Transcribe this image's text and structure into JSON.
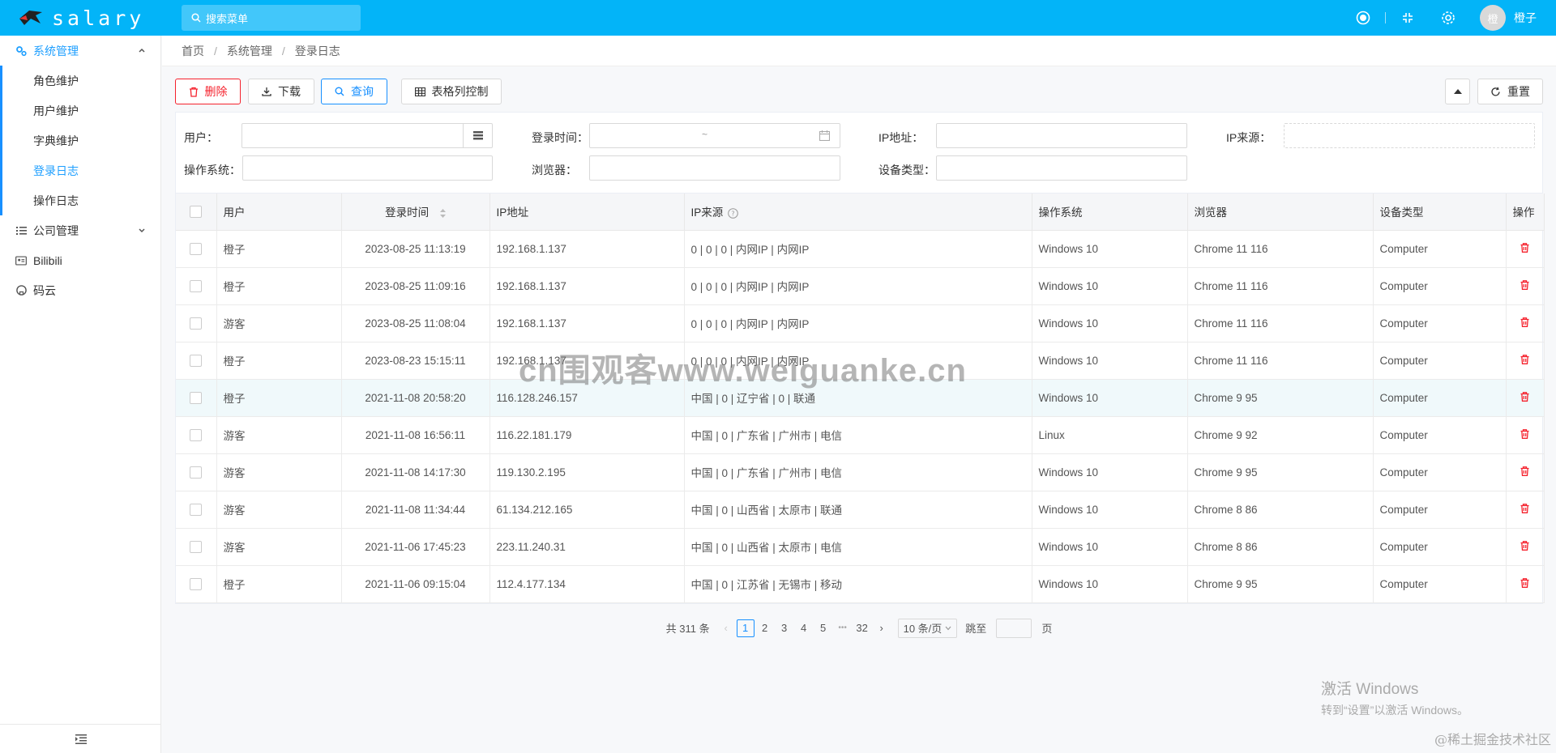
{
  "header": {
    "logo_text": "salary",
    "search_placeholder": "搜索菜单",
    "username": "橙子",
    "avatar_char": "橙"
  },
  "sidebar": {
    "groups": [
      {
        "label": "系统管理",
        "icon": "gears-icon",
        "expanded": true,
        "items": [
          "角色维护",
          "用户维护",
          "字典维护",
          "登录日志",
          "操作日志"
        ],
        "active_item": "登录日志"
      },
      {
        "label": "公司管理",
        "icon": "list-icon",
        "expanded": false
      },
      {
        "label": "Bilibili",
        "icon": "id-card-icon"
      },
      {
        "label": "码云",
        "icon": "github-icon"
      }
    ]
  },
  "breadcrumb": [
    "首页",
    "系统管理",
    "登录日志"
  ],
  "toolbar": {
    "delete": "删除",
    "download": "下载",
    "query": "查询",
    "column_control": "表格列控制",
    "reset": "重置"
  },
  "filters": {
    "user": "用户：",
    "login_time": "登录时间：",
    "range_sep": "~",
    "ip": "IP地址：",
    "ip_source": "IP来源：",
    "os": "操作系统：",
    "browser": "浏览器：",
    "device": "设备类型："
  },
  "table": {
    "columns": [
      "用户",
      "登录时间",
      "IP地址",
      "IP来源",
      "操作系统",
      "浏览器",
      "设备类型",
      "操作"
    ],
    "rows": [
      [
        "橙子",
        "2023-08-25 11:13:19",
        "192.168.1.137",
        "0 | 0 | 0 | 内网IP | 内网IP",
        "Windows 10",
        "Chrome 11 116",
        "Computer"
      ],
      [
        "橙子",
        "2023-08-25 11:09:16",
        "192.168.1.137",
        "0 | 0 | 0 | 内网IP | 内网IP",
        "Windows 10",
        "Chrome 11 116",
        "Computer"
      ],
      [
        "游客",
        "2023-08-25 11:08:04",
        "192.168.1.137",
        "0 | 0 | 0 | 内网IP | 内网IP",
        "Windows 10",
        "Chrome 11 116",
        "Computer"
      ],
      [
        "橙子",
        "2023-08-23 15:15:11",
        "192.168.1.137",
        "0 | 0 | 0 | 内网IP | 内网IP",
        "Windows 10",
        "Chrome 11 116",
        "Computer"
      ],
      [
        "橙子",
        "2021-11-08 20:58:20",
        "116.128.246.157",
        "中国 | 0 | 辽宁省 | 0 | 联通",
        "Windows 10",
        "Chrome 9 95",
        "Computer"
      ],
      [
        "游客",
        "2021-11-08 16:56:11",
        "116.22.181.179",
        "中国 | 0 | 广东省 | 广州市 | 电信",
        "Linux",
        "Chrome 9 92",
        "Computer"
      ],
      [
        "游客",
        "2021-11-08 14:17:30",
        "119.130.2.195",
        "中国 | 0 | 广东省 | 广州市 | 电信",
        "Windows 10",
        "Chrome 9 95",
        "Computer"
      ],
      [
        "游客",
        "2021-11-08 11:34:44",
        "61.134.212.165",
        "中国 | 0 | 山西省 | 太原市 | 联通",
        "Windows 10",
        "Chrome 8 86",
        "Computer"
      ],
      [
        "游客",
        "2021-11-06 17:45:23",
        "223.11.240.31",
        "中国 | 0 | 山西省 | 太原市 | 电信",
        "Windows 10",
        "Chrome 8 86",
        "Computer"
      ],
      [
        "橙子",
        "2021-11-06 09:15:04",
        "112.4.177.134",
        "中国 | 0 | 江苏省 | 无锡市 | 移动",
        "Windows 10",
        "Chrome 9 95",
        "Computer"
      ]
    ],
    "highlight_row": 4
  },
  "pagination": {
    "total": "共 311 条",
    "pages": [
      "1",
      "2",
      "3",
      "4",
      "5"
    ],
    "ellipsis": "•••",
    "last": "32",
    "current": "1",
    "page_size": "10 条/页",
    "jump_prefix": "跳至",
    "jump_suffix": "页"
  },
  "overlay": {
    "watermark": "cn围观客www.weiguanke.cn",
    "activate_title": "激活 Windows",
    "activate_sub": "转到“设置”以激活 Windows。",
    "credit": "@稀土掘金技术社区"
  },
  "colors": {
    "header": "#03b4f8",
    "accent": "#1890ff",
    "danger": "#f5222d"
  }
}
